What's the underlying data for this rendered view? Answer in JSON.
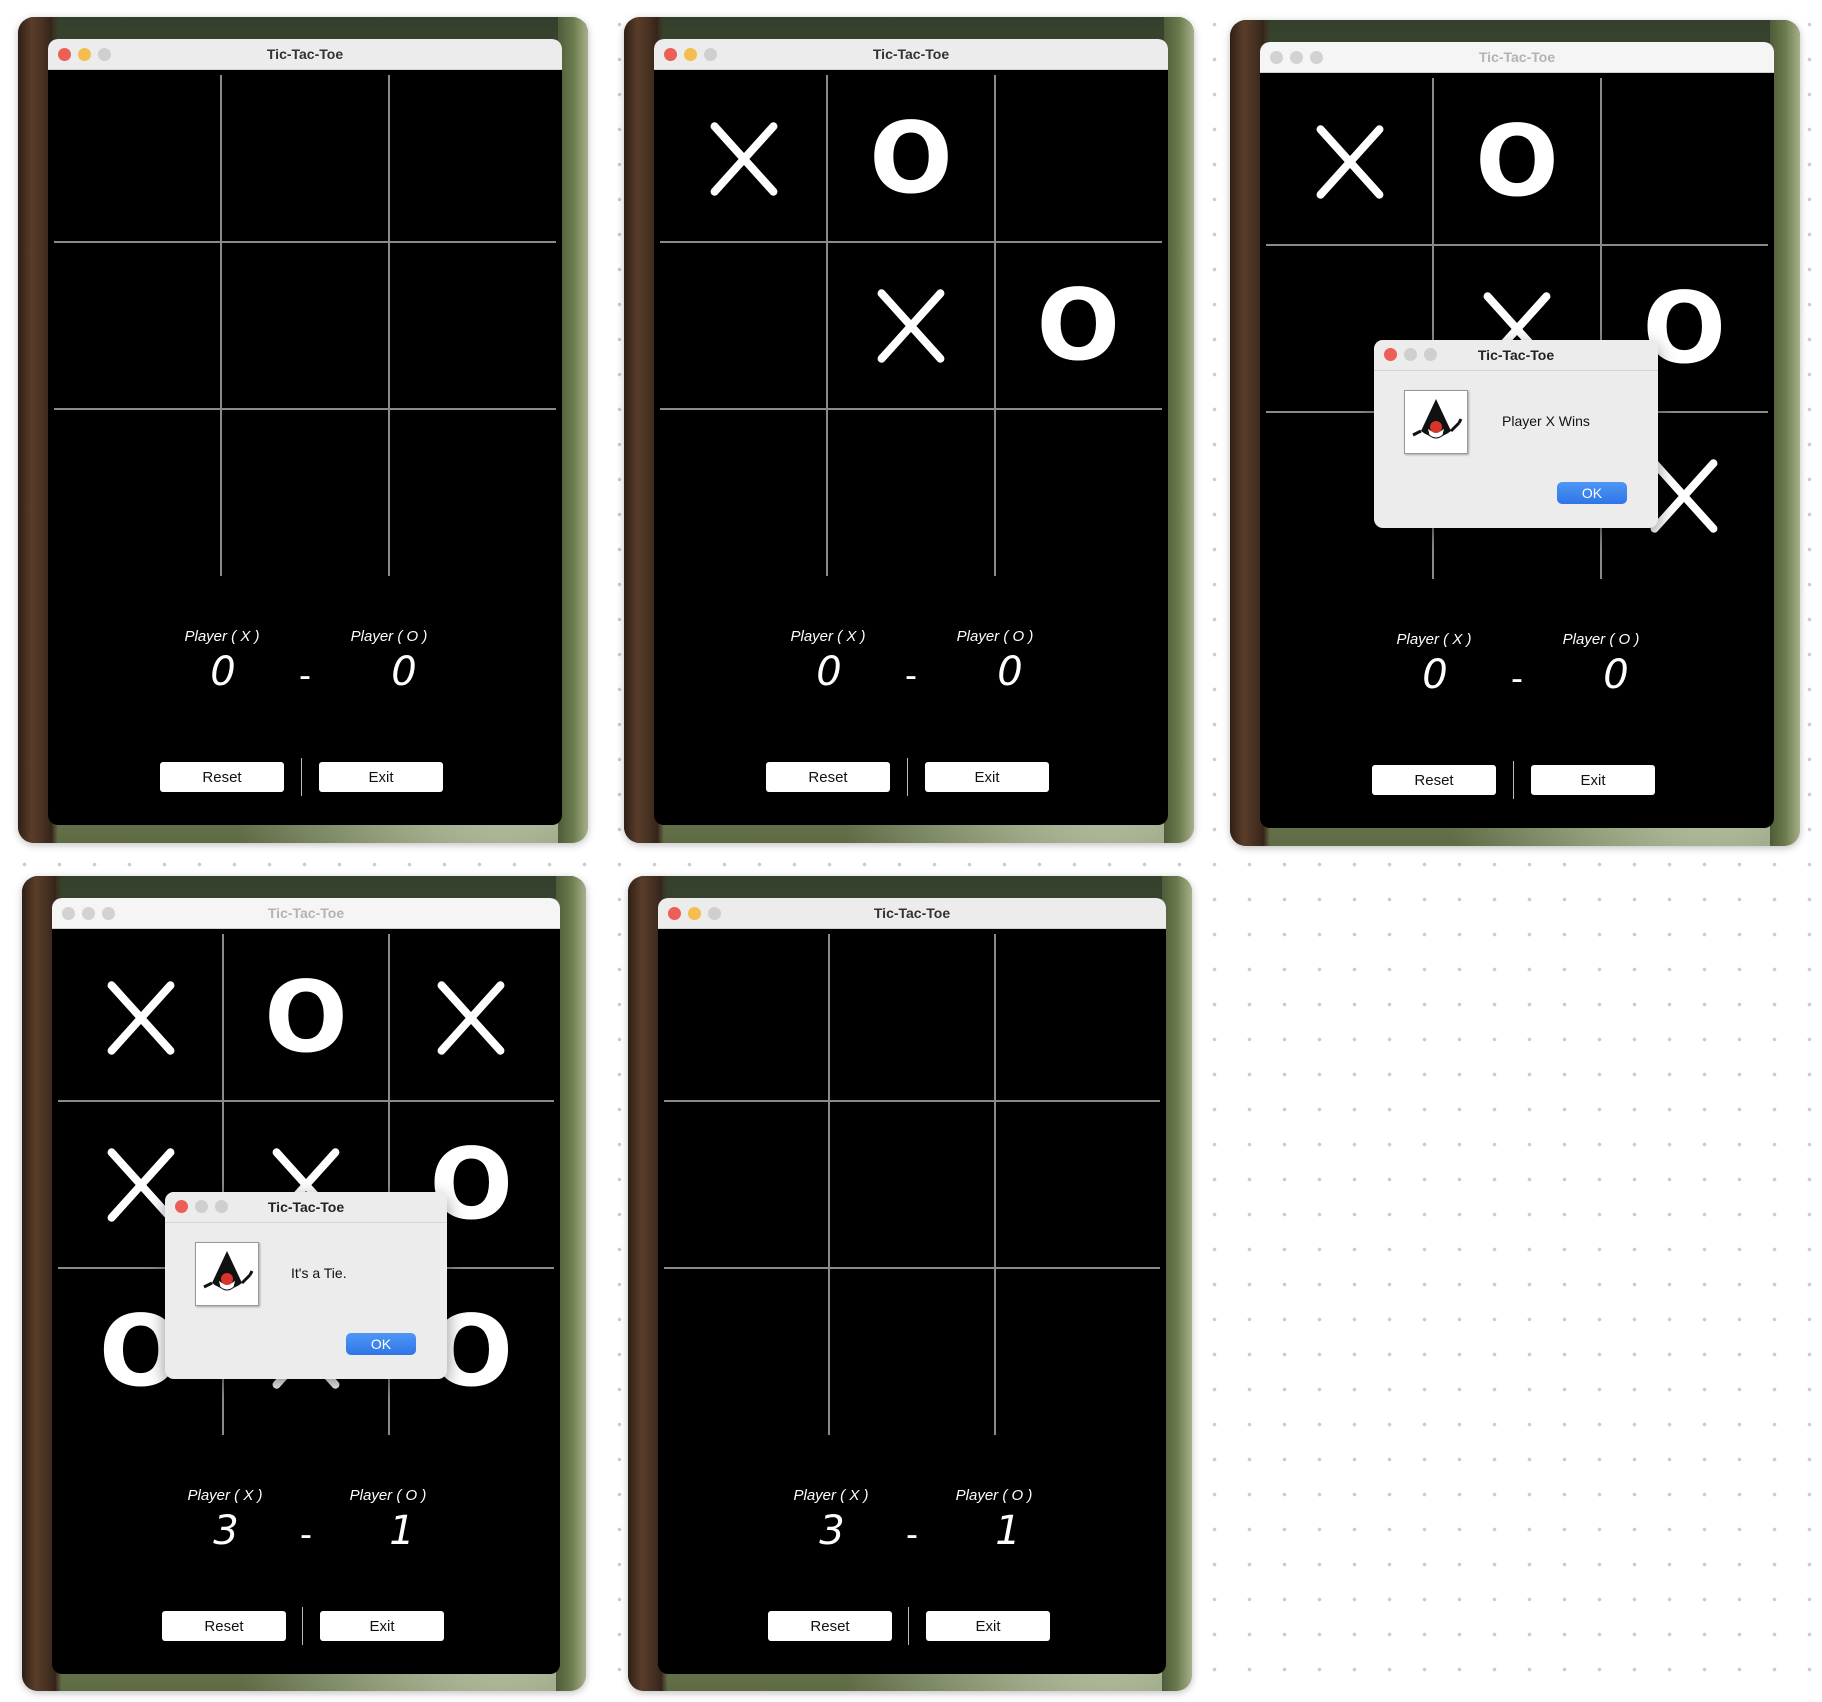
{
  "window_title": "Tic-Tac-Toe",
  "player_x_label": "Player ( X )",
  "player_o_label": "Player ( O )",
  "score_separator": "-",
  "reset_label": "Reset",
  "exit_label": "Exit",
  "ok_label": "OK",
  "colors": {
    "close": "#ec5f56",
    "minimize": "#f4bd4f",
    "ok_button": "#2f75e8",
    "board": "#000000"
  },
  "icons": {
    "dialog_icon": "java-duke-icon"
  },
  "screens": [
    {
      "title": "Tic-Tac-Toe",
      "active": true,
      "board": [
        "",
        "",
        "",
        "",
        "",
        "",
        "",
        "",
        ""
      ],
      "score_x": "0",
      "score_o": "0",
      "dialog": null
    },
    {
      "title": "Tic-Tac-Toe",
      "active": true,
      "board": [
        "X",
        "O",
        "",
        "",
        "X",
        "O",
        "",
        "",
        ""
      ],
      "score_x": "0",
      "score_o": "0",
      "dialog": null
    },
    {
      "title": "Tic-Tac-Toe",
      "active": false,
      "board": [
        "X",
        "O",
        "",
        "",
        "X",
        "O",
        "",
        "",
        "X"
      ],
      "score_x": "0",
      "score_o": "0",
      "dialog": {
        "title": "Tic-Tac-Toe",
        "message": "Player X Wins",
        "ok": "OK"
      }
    },
    {
      "title": "Tic-Tac-Toe",
      "active": false,
      "board": [
        "X",
        "O",
        "X",
        "X",
        "X",
        "O",
        "O",
        "X",
        "O"
      ],
      "score_x": "3",
      "score_o": "1",
      "dialog": {
        "title": "Tic-Tac-Toe",
        "message": "It's a Tie.",
        "ok": "OK"
      }
    },
    {
      "title": "Tic-Tac-Toe",
      "active": true,
      "board": [
        "",
        "",
        "",
        "",
        "",
        "",
        "",
        "",
        ""
      ],
      "score_x": "3",
      "score_o": "1",
      "dialog": null
    }
  ]
}
